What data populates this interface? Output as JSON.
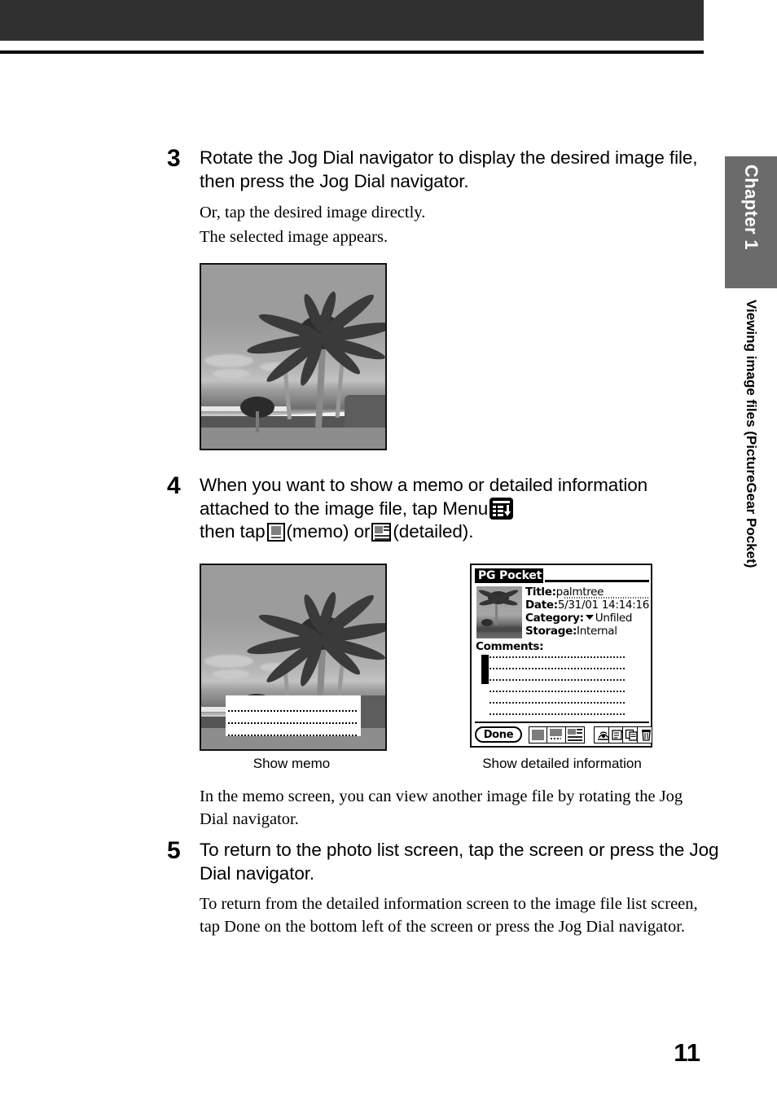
{
  "header": {
    "bar_color": "#303030",
    "rule_color": "#000000"
  },
  "sidebar": {
    "chapter_label": "Chapter 1",
    "chapter_tab_color": "#6b6b6b",
    "section_title": "Viewing image files (PictureGear Pocket)"
  },
  "steps": [
    {
      "number": "3",
      "heading": "Rotate the Jog Dial navigator to display the desired image file, then press the Jog Dial navigator.",
      "lines": [
        "Or, tap the desired image directly.",
        "The selected image appears."
      ]
    },
    {
      "number": "4",
      "heading_part1": "When you want to show a memo or detailed information attached to the image file, tap Menu",
      "heading_part2": "then tap",
      "heading_part3": "(memo) or",
      "heading_part4": "(detailed).",
      "icons": {
        "menu": "menu-icon",
        "memo": "memo-icon",
        "detailed": "detailed-info-icon"
      }
    },
    {
      "number": "5",
      "heading": "To return to the photo list screen, tap the screen or press the Jog Dial navigator.",
      "lines": [
        "To return from the detailed information screen to the image file list screen, tap Done on the bottom left of the screen or press the Jog Dial navigator."
      ]
    }
  ],
  "note_after_step4": "In the memo screen, you can view another image file by rotating the Jog Dial navigator.",
  "figures": {
    "photo_step3_alt": "palm tree photo on Clie screen",
    "memo_caption": "Show memo",
    "detail_caption": "Show detailed information"
  },
  "pda": {
    "app_title": "PG Pocket",
    "fields": [
      {
        "label": "Title:",
        "value": "palmtree"
      },
      {
        "label": "Date:",
        "value": "5/31/01 14:14:16"
      },
      {
        "label": "Category:",
        "value": "Unfiled",
        "has_dropdown": true
      },
      {
        "label": "Storage:",
        "value": "Internal"
      }
    ],
    "comments_label": "Comments:",
    "done_button": "Done",
    "toolbar_icons_left": [
      "full-image-icon",
      "memo-view-icon",
      "detailed-view-icon"
    ],
    "toolbar_icons_right": [
      "beam-icon",
      "export-icon",
      "copy-icon",
      "trash-icon"
    ]
  },
  "page_number": "11"
}
